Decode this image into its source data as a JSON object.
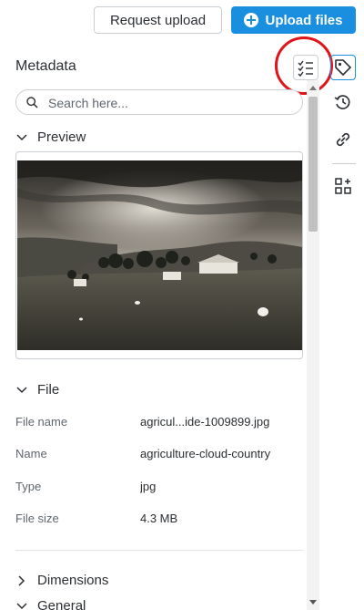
{
  "toolbar": {
    "request_upload_label": "Request upload",
    "upload_files_label": "Upload files"
  },
  "panel": {
    "title": "Metadata",
    "search_placeholder": "Search here..."
  },
  "sections": {
    "preview": "Preview",
    "file": "File",
    "dimensions": "Dimensions",
    "general": "General"
  },
  "file_fields": [
    {
      "label": "File name",
      "value": "agricul...ide-1009899.jpg"
    },
    {
      "label": "Name",
      "value": "agriculture-cloud-country"
    },
    {
      "label": "Type",
      "value": "jpg"
    },
    {
      "label": "File size",
      "value": "4.3 MB"
    }
  ],
  "rail_icons": [
    "tag-icon",
    "history-icon",
    "link-icon",
    "add-widget-icon"
  ],
  "colors": {
    "accent": "#1a8fe0",
    "highlight": "#e0141b"
  }
}
